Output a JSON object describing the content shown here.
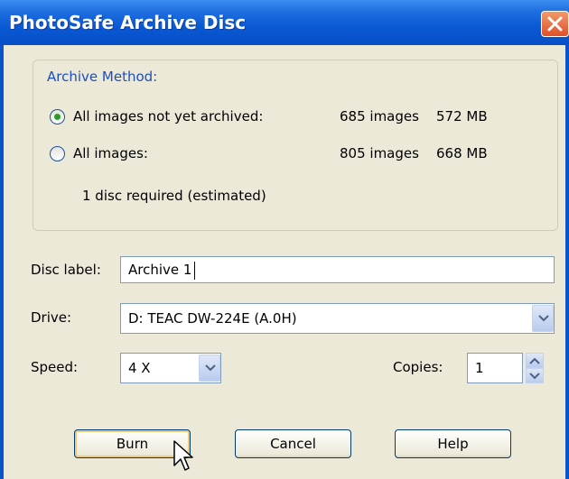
{
  "window": {
    "title": "PhotoSafe Archive Disc"
  },
  "archive_method": {
    "legend": "Archive Method:",
    "options": [
      {
        "label": "All images not yet archived:",
        "images": "685 images",
        "size": "572 MB",
        "selected": true
      },
      {
        "label": "All images:",
        "images": "805 images",
        "size": "668 MB",
        "selected": false
      }
    ],
    "discs_required": "1 disc required (estimated)"
  },
  "form": {
    "disc_label_label": "Disc label:",
    "disc_label_value": "Archive 1",
    "drive_label": "Drive:",
    "drive_value": "D: TEAC DW-224E (A.0H)",
    "speed_label": "Speed:",
    "speed_value": "4 X",
    "copies_label": "Copies:",
    "copies_value": "1"
  },
  "buttons": {
    "burn": "Burn",
    "cancel": "Cancel",
    "help": "Help"
  },
  "colors": {
    "title_bar": "#0a58d4",
    "legend_text": "#1b4fbf",
    "dialog_bg": "#ece9d8"
  }
}
